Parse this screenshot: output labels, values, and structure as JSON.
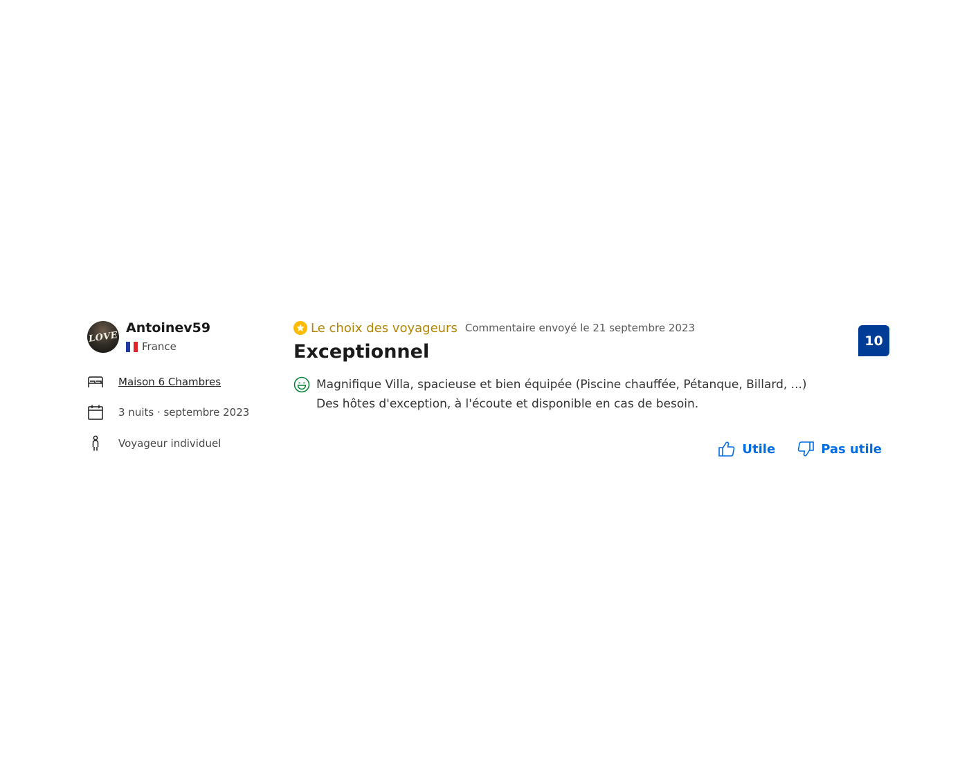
{
  "reviewer": {
    "name": "Antoinev59",
    "country": "France",
    "avatar_text": "LOVE",
    "room_type": "Maison 6 Chambres",
    "stay": "3 nuits · septembre 2023",
    "traveller_type": "Voyageur individuel"
  },
  "review": {
    "badge_label": "Le choix des voyageurs",
    "date": "Commentaire envoyé le 21 septembre 2023",
    "title": "Exceptionnel",
    "positive_lines": [
      "Magnifique Villa, spacieuse et bien équipée (Piscine chauffée, Pétanque, Billard, ...)",
      "Des hôtes d'exception, à l'écoute et disponible en cas de besoin."
    ],
    "score": "10"
  },
  "actions": {
    "helpful_label": "Utile",
    "not_helpful_label": "Pas utile"
  },
  "colors": {
    "accent": "#006ce4",
    "score_bg": "#003b95",
    "badge": "#febb02",
    "badge_text": "#b38500",
    "positive": "#008234"
  },
  "icons": {
    "badge": "star-circle-icon",
    "room": "bed-icon",
    "stay": "calendar-icon",
    "traveller": "person-icon",
    "positive": "smiley-icon",
    "helpful": "thumbs-up-icon",
    "not_helpful": "thumbs-down-icon"
  }
}
